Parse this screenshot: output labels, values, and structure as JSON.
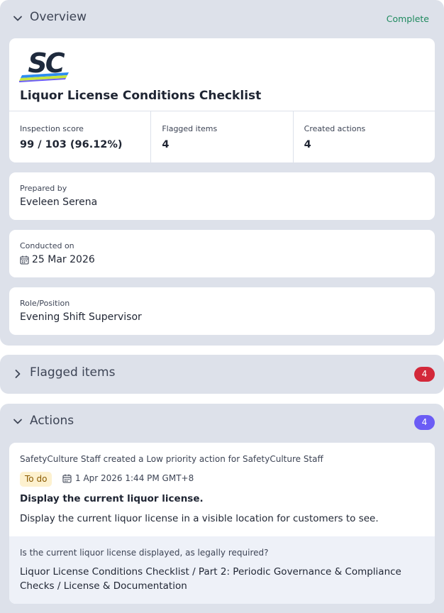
{
  "overview": {
    "title": "Overview",
    "status": "Complete",
    "logo_text": "SC",
    "checklist_title": "Liquor License Conditions Checklist",
    "stats": [
      {
        "label": "Inspection score",
        "value": "99 / 103 (96.12%)"
      },
      {
        "label": "Flagged items",
        "value": "4"
      },
      {
        "label": "Created actions",
        "value": "4"
      }
    ],
    "prepared_by": {
      "label": "Prepared by",
      "value": "Eveleen Serena"
    },
    "conducted_on": {
      "label": "Conducted on",
      "value": "25 Mar 2026",
      "icon": "calendar-icon"
    },
    "role": {
      "label": "Role/Position",
      "value": "Evening Shift Supervisor"
    }
  },
  "flagged": {
    "title": "Flagged items",
    "count": "4"
  },
  "actions": {
    "title": "Actions",
    "count": "4",
    "items": [
      {
        "meta": "SafetyCulture Staff created a Low priority action for SafetyCulture Staff",
        "status": "To do",
        "due": "1 Apr 2026 1:44 PM GMT+8",
        "title": "Display the current liquor license.",
        "description": "Display the current liquor license in a visible location for customers to see.",
        "question": "Is the current liquor license displayed, as legally required?",
        "path": "Liquor License Conditions Checklist / Part 2: Periodic Governance & Compliance Checks / License & Documentation"
      }
    ]
  },
  "colors": {
    "section_bg": "#dde1ea",
    "complete": "#1f8a5f",
    "flag_badge": "#d3283a",
    "action_badge": "#6b5cf5",
    "todo_bg": "#fdf1cf",
    "logo_dark": "#1e2a3d"
  }
}
